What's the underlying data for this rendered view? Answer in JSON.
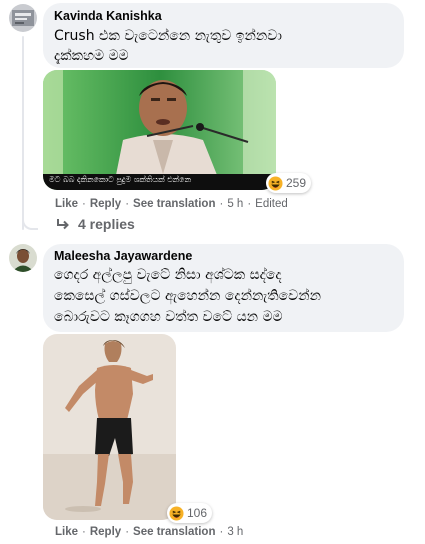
{
  "comments": [
    {
      "author": "Kavinda Kanishka",
      "text_lines": [
        "Crush එක වැටෙන්නෙ නැතුව ඉන්නවා",
        "දැක්කහම මම"
      ],
      "image_caption": "මට බබ දකිනකොට පුදුම ශක්තියක් එන්නෙ",
      "reaction_count": "259",
      "actions": {
        "like": "Like",
        "reply": "Reply",
        "translate": "See translation",
        "time": "5 h",
        "edited": "Edited"
      },
      "replies": "4 replies"
    },
    {
      "author": "Maleesha Jayawardene",
      "text_lines": [
        "ගෙදර අල්ලපු වැටේ නිසා අශ්ටක සද්දෙ",
        "කෙසෙල් ගස්වලට ඇහෙන්න දෙන්නැතිවෙන්න",
        "බොරුවට කෑගගහ වත්ත වටේ යන මම"
      ],
      "reaction_count": "106",
      "actions": {
        "like": "Like",
        "reply": "Reply",
        "translate": "See translation",
        "time": "3 h"
      }
    }
  ],
  "colors": {
    "bubble": "#f0f2f5",
    "meta": "#65676b",
    "thread": "#e4e6eb",
    "reaction": "#f7b125"
  },
  "icons": {
    "reaction": "haha-emoji-icon",
    "replies": "reply-arrow-icon"
  }
}
